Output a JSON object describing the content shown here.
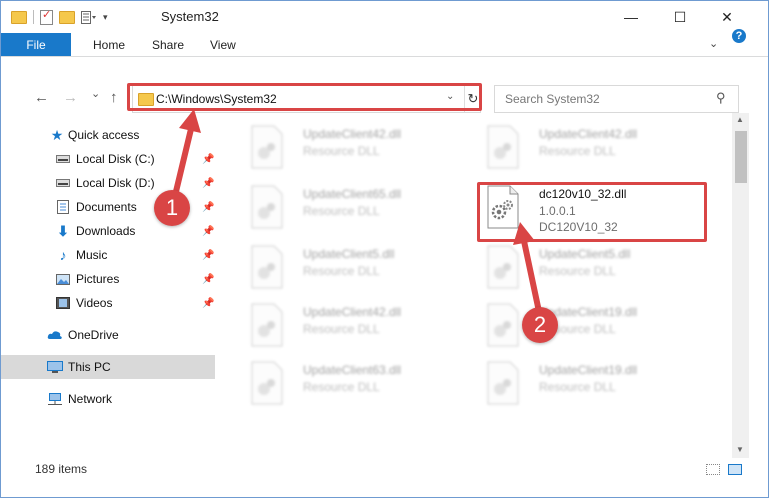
{
  "window": {
    "title": "System32",
    "minimize": "—",
    "maximize": "☐",
    "close": "✕"
  },
  "ribbon": {
    "tabs": [
      "File",
      "Home",
      "Share",
      "View"
    ],
    "help": "?"
  },
  "nav": {
    "back": "←",
    "forward": "→",
    "recent": "⌄",
    "up": "↑",
    "address": "C:\\Windows\\System32",
    "refresh": "↻",
    "search_placeholder": "Search System32"
  },
  "sidebar": {
    "items": [
      {
        "label": "Quick access",
        "icon": "star-icon"
      },
      {
        "label": "Local Disk (C:)",
        "icon": "drive-icon",
        "pinned": true
      },
      {
        "label": "Local Disk (D:)",
        "icon": "drive-icon",
        "pinned": true
      },
      {
        "label": "Documents",
        "icon": "documents-icon",
        "pinned": true
      },
      {
        "label": "Downloads",
        "icon": "download-icon",
        "pinned": true
      },
      {
        "label": "Music",
        "icon": "music-icon",
        "pinned": true
      },
      {
        "label": "Pictures",
        "icon": "pictures-icon",
        "pinned": true
      },
      {
        "label": "Videos",
        "icon": "videos-icon",
        "pinned": true
      },
      {
        "label": "OneDrive",
        "icon": "cloud-icon"
      },
      {
        "label": "This PC",
        "icon": "computer-icon",
        "selected": true
      },
      {
        "label": "Network",
        "icon": "network-icon"
      }
    ]
  },
  "files": [
    {
      "name": "UpdateClient42.dll",
      "desc": "Resource DLL"
    },
    {
      "name": "UpdateClient42.dll",
      "desc": "Resource DLL"
    },
    {
      "name": "UpdateClient65.dll",
      "desc": "Resource DLL"
    },
    {
      "name": "dc120v10_32.dll",
      "desc": "1.0.0.1",
      "desc2": "DC120V10_32"
    },
    {
      "name": "UpdateClient5.dll",
      "desc": "Resource DLL"
    },
    {
      "name": "UpdateClient5.dll",
      "desc": "Resource DLL"
    },
    {
      "name": "UpdateClient42.dll",
      "desc": "Resource DLL"
    },
    {
      "name": "UpdateClient19.dll",
      "desc": "Resource DLL"
    },
    {
      "name": "UpdateClient63.dll",
      "desc": "Resource DLL"
    },
    {
      "name": "UpdateClient19.dll",
      "desc": "Resource DLL"
    }
  ],
  "status": {
    "items": "189 items"
  },
  "callouts": [
    "1",
    "2"
  ],
  "colors": {
    "accent": "#1979ca",
    "highlight": "#d94545",
    "selected_bg": "#d9d9d9"
  }
}
